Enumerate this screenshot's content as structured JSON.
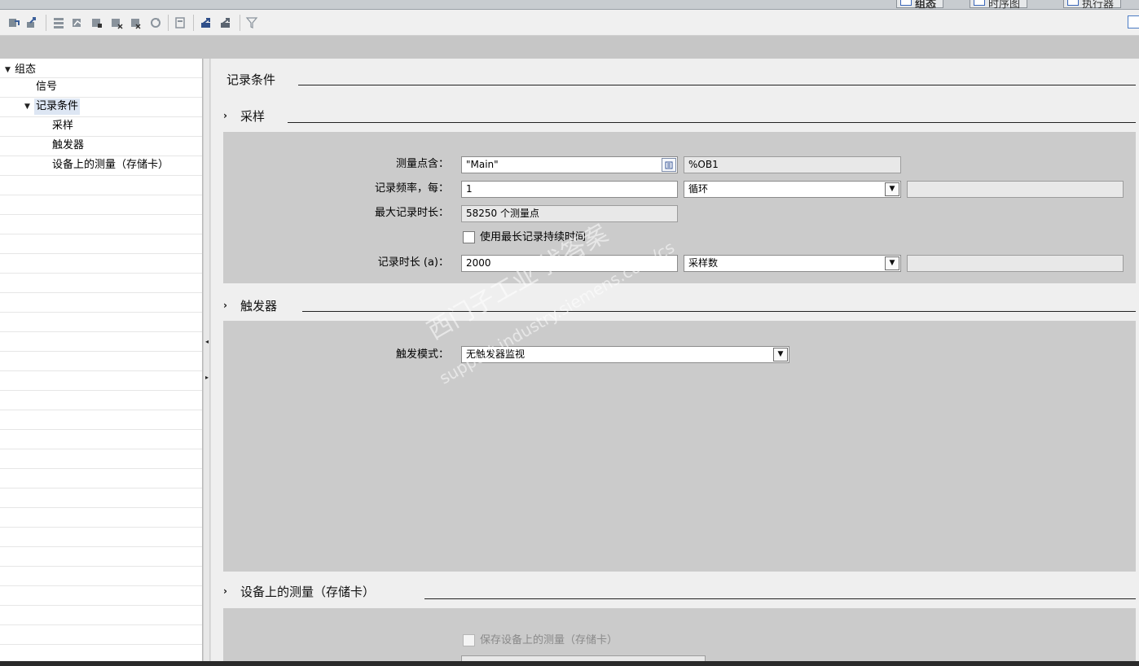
{
  "view_tabs": [
    {
      "label": "组态",
      "icon": "config-icon"
    },
    {
      "label": "时序图",
      "icon": "timing-diagram-icon"
    },
    {
      "label": "执行器",
      "icon": "function-icon"
    }
  ],
  "toolbar": {
    "buttons": [
      "download-icon",
      "upload-icon",
      "monitor-all-icon",
      "monitor-icon",
      "record-icon",
      "stop-record-icon",
      "refresh-icon",
      "install-icon",
      "export-icon",
      "import-icon",
      "filter-icon"
    ]
  },
  "nav": {
    "items": [
      {
        "label": "组态",
        "level": 0,
        "expanded": true
      },
      {
        "label": "信号",
        "level": 1
      },
      {
        "label": "记录条件",
        "level": 1,
        "expanded": true,
        "selected": true
      },
      {
        "label": "采样",
        "level": 2
      },
      {
        "label": "触发器",
        "level": 2
      },
      {
        "label": "设备上的测量（存储卡）",
        "level": 2
      }
    ]
  },
  "main": {
    "title": "记录条件",
    "sampling": {
      "title": "采样",
      "measure_point_label": "测量点含：",
      "measure_point_value": "\"Main\"",
      "measure_point_ob": "%OB1",
      "freq_label": "记录频率，每：",
      "freq_value": "1",
      "freq_unit": "循环",
      "max_duration_label": "最大记录时长：",
      "max_duration_value": "58250 个测量点",
      "use_max_label": "使用最长记录持续时间",
      "use_max_checked": false,
      "duration_label": "记录时长 (a)：",
      "duration_value": "2000",
      "duration_unit": "采样数"
    },
    "trigger": {
      "title": "触发器",
      "mode_label": "触发模式：",
      "mode_value": "无触发器监视"
    },
    "device": {
      "title": "设备上的测量（存储卡）",
      "save_label": "保存设备上的测量（存储卡）",
      "save_checked": false
    }
  },
  "watermark": {
    "line1": "西门子工业 找答案",
    "line2": "support.industry.siemens.com/cs"
  }
}
